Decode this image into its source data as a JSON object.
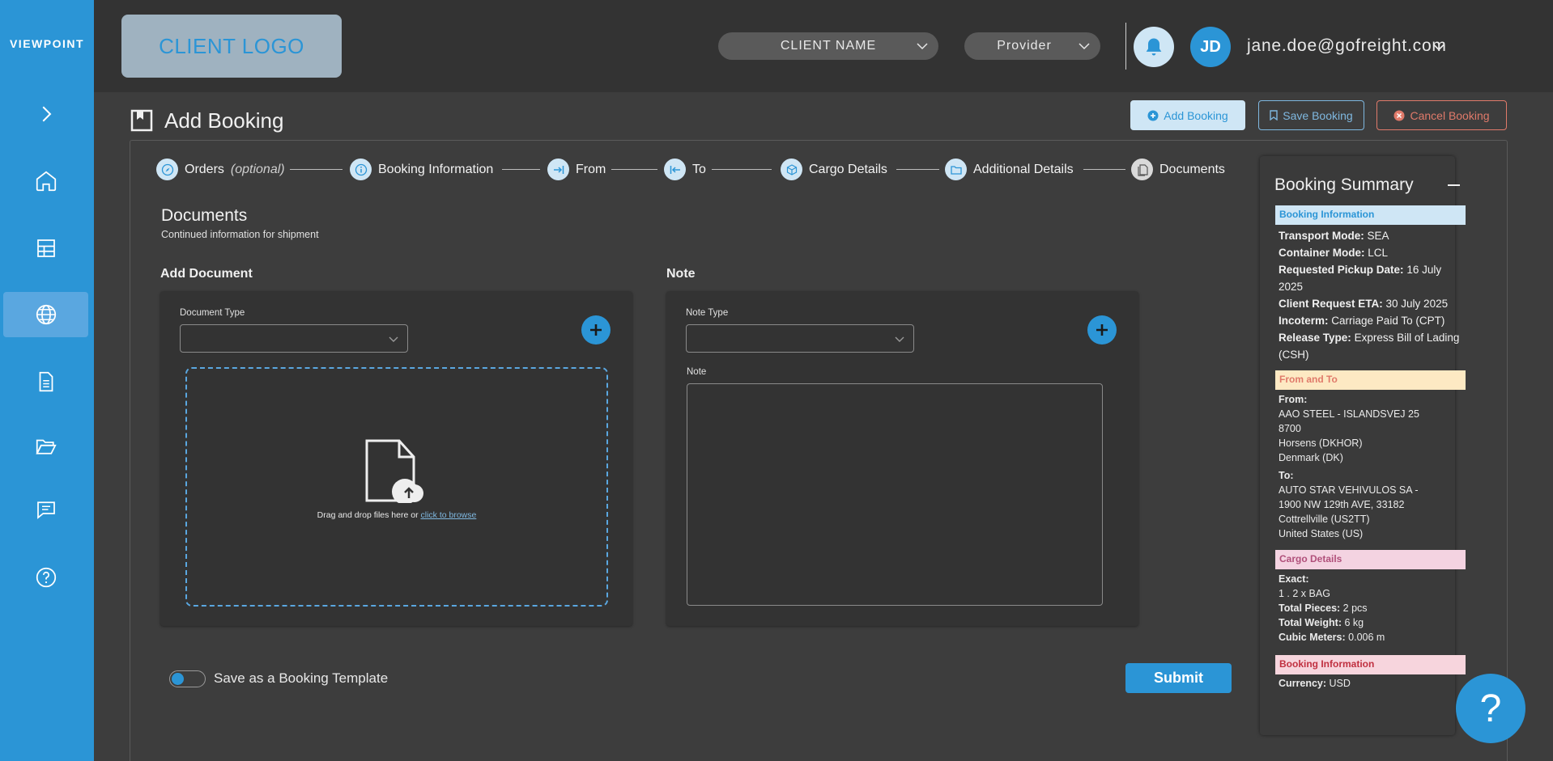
{
  "sidebar": {
    "brand": "VIEWPOINT",
    "items": [
      "expand",
      "home",
      "table",
      "globe",
      "document",
      "folder",
      "message",
      "help"
    ]
  },
  "topbar": {
    "client_logo": "CLIENT LOGO",
    "client_name": "CLIENT NAME",
    "provider": "Provider",
    "avatar_initials": "JD",
    "email": "jane.doe@gofreight.com"
  },
  "page": {
    "title": "Add Booking",
    "buttons": {
      "add": "Add Booking",
      "save": "Save Booking",
      "cancel": "Cancel Booking"
    }
  },
  "stepper": {
    "orders": "Orders",
    "orders_optional": "(optional)",
    "booking_info": "Booking Information",
    "from": "From",
    "to": "To",
    "cargo": "Cargo Details",
    "additional": "Additional Details",
    "documents": "Documents"
  },
  "section": {
    "title": "Documents",
    "subtitle": "Continued information for shipment"
  },
  "add_document": {
    "heading": "Add Document",
    "type_label": "Document Type",
    "drop_text": "Drag and drop files here or",
    "browse_link": "click to browse"
  },
  "note": {
    "heading": "Note",
    "type_label": "Note Type",
    "note_label": "Note"
  },
  "footer": {
    "template_toggle": "Save as a Booking Template",
    "submit": "Submit"
  },
  "summary": {
    "title": "Booking Summary",
    "booking_tag": "Booking Information",
    "transport_label": "Transport Mode:",
    "transport_value": "SEA",
    "container_label": "Container Mode:",
    "container_value": "LCL",
    "pickup_label": "Requested Pickup Date:",
    "pickup_value": "16 July 2025",
    "eta_label": "Client Request ETA:",
    "eta_value": "30 July 2025",
    "incoterm_label": "Incoterm:",
    "incoterm_value": "Carriage Paid To (CPT)",
    "release_label": "Release Type:",
    "release_value": "Express Bill of Lading (CSH)",
    "from_to_tag": "From and To",
    "from_label": "From:",
    "from_lines": [
      "AAO STEEL - ISLANDSVEJ 25",
      "8700",
      "Horsens (DKHOR)",
      "Denmark (DK)"
    ],
    "to_label": "To:",
    "to_lines": [
      "AUTO STAR VEHIVULOS SA -",
      "1900 NW 129th AVE, 33182",
      "Cottrellville (US2TT)",
      "United States (US)"
    ],
    "cargo_tag": "Cargo Details",
    "exact_label": "Exact:",
    "exact_item": "1 . 2 x BAG",
    "pieces_label": "Total Pieces:",
    "pieces_value": "2 pcs",
    "weight_label": "Total Weight:",
    "weight_value": "6 kg",
    "cubic_label": "Cubic Meters:",
    "cubic_value": "0.006 m",
    "booking_tag2": "Booking Information",
    "currency_label": "Currency:",
    "currency_value": "USD"
  },
  "help_fab": "?",
  "colors": {
    "accent": "#2b95d6",
    "tag_booking": "#cfe6f5",
    "tag_from_to": "#fde9c3",
    "tag_cargo": "#f4d3e1",
    "tag_booking2": "#f7d5dd"
  }
}
